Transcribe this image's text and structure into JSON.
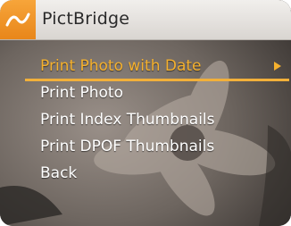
{
  "header": {
    "title": "PictBridge",
    "mode_icon": "pictbridge-mode-icon",
    "accent_color": "#f0972a"
  },
  "menu": {
    "items": [
      {
        "label": "Print Photo with Date",
        "selected": true,
        "has_submenu": true
      },
      {
        "label": "Print Photo",
        "selected": false
      },
      {
        "label": "Print Index Thumbnails",
        "selected": false
      },
      {
        "label": "Print DPOF Thumbnails",
        "selected": false
      },
      {
        "label": "Back",
        "selected": false
      }
    ],
    "selected_color": "#f5b12e",
    "submenu_icon": "arrow-right-icon"
  }
}
